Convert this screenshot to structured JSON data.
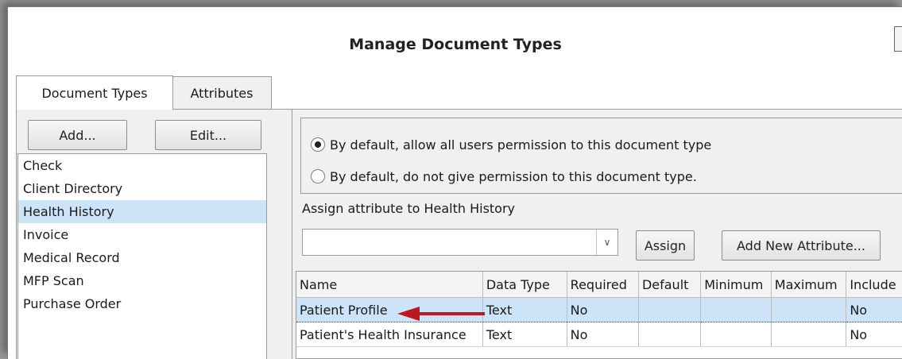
{
  "window": {
    "title": "Manage Document Types"
  },
  "tabs": [
    {
      "label": "Document Types",
      "active": true
    },
    {
      "label": "Attributes",
      "active": false
    }
  ],
  "left": {
    "add_label": "Add...",
    "edit_label": "Edit...",
    "document_types": [
      "Check",
      "Client Directory",
      "Health History",
      "Invoice",
      "Medical Record",
      "MFP Scan",
      "Purchase Order"
    ],
    "selected": "Health History"
  },
  "permissions": {
    "option_allow": "By default, allow all users permission to this document type",
    "option_deny": "By default, do not give permission to this document type.",
    "selected": "allow"
  },
  "assign": {
    "label": "Assign attribute to Health History",
    "combo_value": "",
    "assign_label": "Assign",
    "add_new_label": "Add New Attribute..."
  },
  "attributes_grid": {
    "columns": [
      "Name",
      "Data Type",
      "Required",
      "Default",
      "Minimum",
      "Maximum",
      "Include"
    ],
    "rows": [
      [
        "Patient Profile",
        "Text",
        "No",
        "",
        "",
        "",
        "No"
      ],
      [
        "Patient's Health Insurance",
        "Text",
        "No",
        "",
        "",
        "",
        "No"
      ]
    ],
    "selected_row": 0
  },
  "colors": {
    "selection": "#cde3f7",
    "annotation_arrow": "#c0161f"
  },
  "icons": {
    "combo_dropdown": "chevron-down-icon",
    "annotation": "left-arrow-icon"
  }
}
